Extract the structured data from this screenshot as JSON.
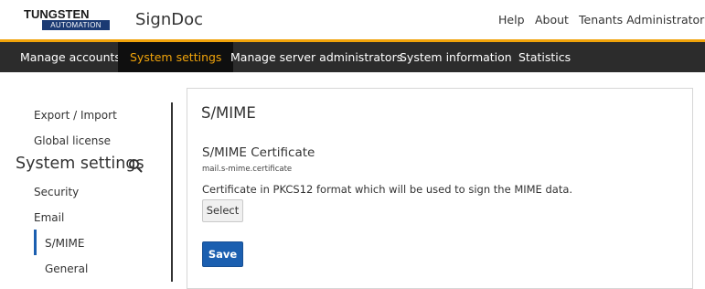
{
  "header": {
    "logo": {
      "brand": "TUNGSTEN",
      "sub": "AUTOMATION"
    },
    "app_title": "SignDoc",
    "links": {
      "help": "Help",
      "about": "About",
      "user": "Tenants Administrator"
    }
  },
  "nav": {
    "items": [
      "Manage accounts",
      "System settings",
      "Manage server administrators",
      "System information",
      "Statistics"
    ],
    "active": "System settings"
  },
  "sidebar": {
    "export_import": "Export / Import",
    "global_license": "Global license",
    "heading": "System settings",
    "security": "Security",
    "email": "Email",
    "smime": "S/MIME",
    "general": "General"
  },
  "panel": {
    "title": "S/MIME",
    "field_title": "S/MIME Certificate",
    "field_key": "mail.s-mime.certificate",
    "field_desc": "Certificate in PKCS12 format which will be used to sign the MIME data.",
    "select_label": "Select",
    "save_label": "Save"
  },
  "colors": {
    "accent": "#f0a30a",
    "primary": "#1b5fb0",
    "navbar": "#2c2c2c"
  }
}
